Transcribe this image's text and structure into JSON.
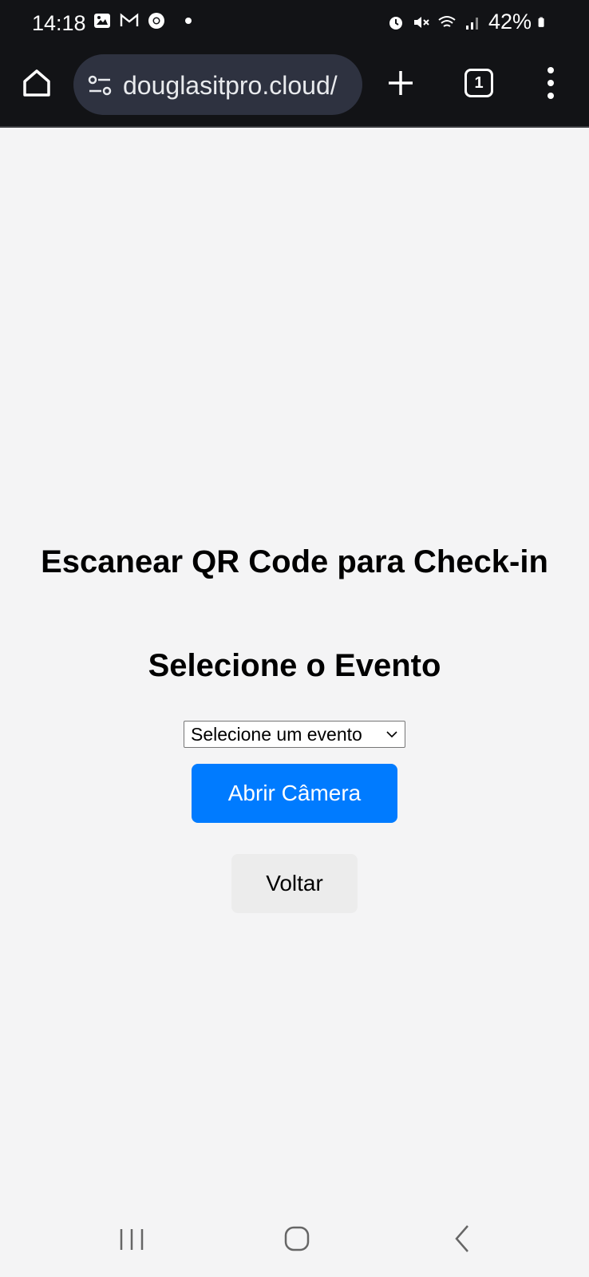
{
  "status_bar": {
    "time": "14:18",
    "battery": "42%"
  },
  "browser": {
    "url": "douglasitpro.cloud/",
    "tab_count": "1"
  },
  "page": {
    "title": "Escanear QR Code para Check-in",
    "subtitle": "Selecione o Evento",
    "event_select": {
      "selected": "Selecione um evento"
    },
    "camera_button": "Abrir Câmera",
    "back_button": "Voltar"
  },
  "colors": {
    "primary": "#007bff",
    "chrome_bg": "#121316",
    "page_bg": "#f4f4f5",
    "omnibox_bg": "#2e3240"
  }
}
